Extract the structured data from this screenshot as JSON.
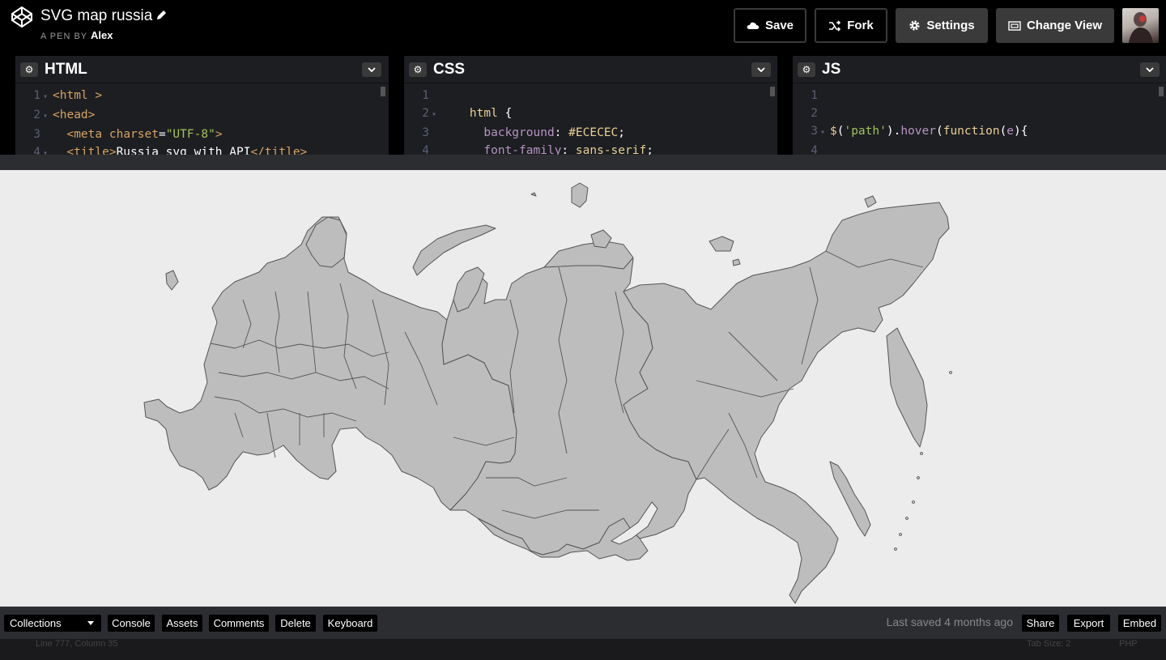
{
  "header": {
    "title": "SVG map russia",
    "byline_prefix": "A PEN BY",
    "author": "Alex",
    "save_label": "Save",
    "fork_label": "Fork",
    "settings_label": "Settings",
    "change_view_label": "Change View"
  },
  "editors": {
    "html": {
      "title": "HTML",
      "lines": [
        {
          "num": "1",
          "fold": "▾",
          "parts": [
            [
              "tag",
              "<html >"
            ]
          ]
        },
        {
          "num": "2",
          "fold": "▾",
          "parts": [
            [
              "tag",
              "<head>"
            ]
          ]
        },
        {
          "num": "3",
          "fold": "",
          "parts": [
            [
              "txt",
              "  "
            ],
            [
              "tag",
              "<meta "
            ],
            [
              "attr",
              "charset"
            ],
            [
              "punc",
              "="
            ],
            [
              "str",
              "\"UTF-8\""
            ],
            [
              "tag",
              ">"
            ]
          ]
        },
        {
          "num": "4",
          "fold": "▾",
          "parts": [
            [
              "txt",
              "  "
            ],
            [
              "tag",
              "<title>"
            ],
            [
              "txt",
              "Russia svg with API"
            ],
            [
              "tag",
              "</title>"
            ]
          ]
        }
      ]
    },
    "css": {
      "title": "CSS",
      "lines": [
        {
          "num": "1",
          "fold": "",
          "parts": [
            [
              "txt",
              ""
            ]
          ]
        },
        {
          "num": "2",
          "fold": "▾",
          "parts": [
            [
              "txt",
              "    "
            ],
            [
              "sel",
              "html"
            ],
            [
              "punc",
              " {"
            ]
          ]
        },
        {
          "num": "3",
          "fold": "",
          "parts": [
            [
              "txt",
              "      "
            ],
            [
              "prop",
              "background"
            ],
            [
              "punc",
              ": "
            ],
            [
              "val",
              "#ECECEC"
            ],
            [
              "punc",
              ";"
            ]
          ]
        },
        {
          "num": "4",
          "fold": "",
          "parts": [
            [
              "txt",
              "      "
            ],
            [
              "prop",
              "font-family"
            ],
            [
              "punc",
              ": "
            ],
            [
              "val",
              "sans-serif"
            ],
            [
              "punc",
              ";"
            ]
          ]
        }
      ]
    },
    "js": {
      "title": "JS",
      "lines": [
        {
          "num": "1",
          "fold": "",
          "parts": [
            [
              "txt",
              ""
            ]
          ]
        },
        {
          "num": "2",
          "fold": "",
          "parts": [
            [
              "txt",
              ""
            ]
          ]
        },
        {
          "num": "3",
          "fold": "▾",
          "parts": [
            [
              "val",
              "$"
            ],
            [
              "punc",
              "("
            ],
            [
              "str",
              "'path'"
            ],
            [
              "punc",
              ")."
            ],
            [
              "prop",
              "hover"
            ],
            [
              "punc",
              "("
            ],
            [
              "val",
              "function"
            ],
            [
              "punc",
              "("
            ],
            [
              "prop",
              "e"
            ],
            [
              "punc",
              "){"
            ]
          ]
        },
        {
          "num": "4",
          "fold": "",
          "parts": [
            [
              "txt",
              ""
            ]
          ]
        }
      ]
    }
  },
  "footer": {
    "collections_label": "Collections",
    "console_label": "Console",
    "assets_label": "Assets",
    "comments_label": "Comments",
    "delete_label": "Delete",
    "keyboard_label": "Keyboard",
    "last_saved": "Last saved 4 months ago",
    "share_label": "Share",
    "export_label": "Export",
    "embed_label": "Embed"
  },
  "status": {
    "cursor": "Line 777, Column 35",
    "tab_size": "Tab Size: 2",
    "mode": "PHP"
  },
  "colors": {
    "map_fill": "#bdbdbd",
    "map_stroke": "#555555",
    "preview_bg": "#ECECEC"
  }
}
